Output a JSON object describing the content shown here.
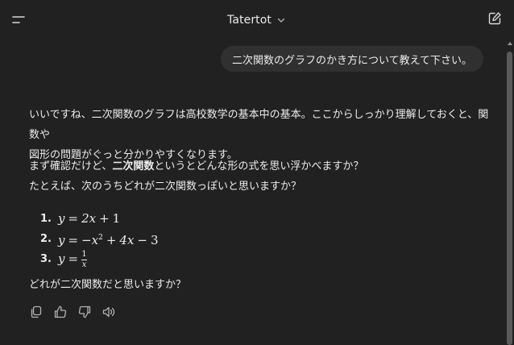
{
  "header": {
    "title": "Tatertot"
  },
  "user_message": "二次関数のグラフのかき方について教えて下さい。",
  "assistant": {
    "para1_line1": "いいですね、二次関数のグラフは高校数学の基本中の基本。ここからしっかり理解しておくと、関数や",
    "para1_line2": "図形の問題がぐっと分かりやすくなります。",
    "para2_prefix": "まず確認だけど、",
    "para2_bold": "二次関数",
    "para2_suffix": "というとどんな形の式を思い浮かべますか？",
    "para2_line2": "たとえば、次のうちどれが二次関数っぽいと思いますか？",
    "list": [
      {
        "num": "1.",
        "expr_label": "y = 2x + 1"
      },
      {
        "num": "2.",
        "expr_label": "y = −x² + 4x − 3"
      },
      {
        "num": "3.",
        "expr_label": "y = 1/x"
      }
    ],
    "closing": "どれが二次関数だと思いますか？"
  },
  "math": {
    "e1_y": "y",
    "e1_eq": "=",
    "e1_a": "2x",
    "e1_plus": "+",
    "e1_b": "1",
    "e2_y": "y",
    "e2_eq": "=",
    "e2_a": "−x",
    "e2_exp": "2",
    "e2_plus": "+",
    "e2_b": "4x",
    "e2_minus": "−",
    "e2_c": "3",
    "e3_y": "y",
    "e3_eq": "=",
    "e3_num": "1",
    "e3_den": "x"
  },
  "icons": {
    "menu": "menu-icon",
    "chevron": "chevron-down-icon",
    "edit": "new-chat-icon",
    "copy": "copy-icon",
    "thumbs_up": "thumbs-up-icon",
    "thumbs_down": "thumbs-down-icon",
    "read_aloud": "speaker-icon"
  },
  "colors": {
    "background": "#212121",
    "bubble": "#303030",
    "text": "#ececec",
    "icon": "#b4b4b4"
  }
}
